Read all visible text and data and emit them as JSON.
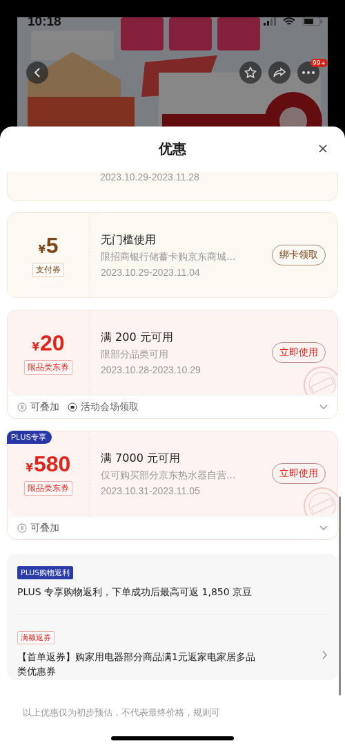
{
  "status_bar": {
    "time": "10:18"
  },
  "product_page": {
    "more_badge": "99+"
  },
  "sheet": {
    "title": "优惠"
  },
  "coupons": [
    {
      "kind": "pay",
      "date": "2023.10.29-2023.11.28"
    },
    {
      "kind": "pay",
      "amount": "5",
      "currency": "¥",
      "tag": "支付券",
      "title": "无门槛使用",
      "desc": "限招商银行储蓄卡购京东商城...",
      "date": "2023.10.29-2023.11.04",
      "action": "绑卡领取",
      "claimed": false
    },
    {
      "kind": "category",
      "amount": "20",
      "currency": "¥",
      "tag": "限品类东券",
      "title": "满 200 元可用",
      "desc": "限部分品类可用",
      "date": "2023.10.28-2023.10.29",
      "action": "立即使用",
      "claimed": true,
      "notes": [
        "可叠加",
        "活动会场领取"
      ]
    },
    {
      "kind": "category",
      "badge": "PLUS专享",
      "amount": "580",
      "currency": "¥",
      "tag": "限品类东券",
      "title": "满 7000 元可用",
      "desc": "仅可购买部分京东热水器自营...",
      "date": "2023.10.31-2023.11.05",
      "action": "立即使用",
      "claimed": true,
      "notes": [
        "可叠加"
      ]
    }
  ],
  "promotions": [
    {
      "kind": "plus",
      "tag": "PLUS购物返利",
      "text": "PLUS 专享购物返利，下单成功后最高可返 1,850 京豆",
      "link": false
    },
    {
      "kind": "return",
      "tag": "满额返券",
      "text": "【首单返券】购家用电器部分商品满1元返家电家居多品类优惠券",
      "link": true
    }
  ],
  "footer": {
    "text": "以上优惠仅为初步预估，不代表最终价格，规则可"
  }
}
